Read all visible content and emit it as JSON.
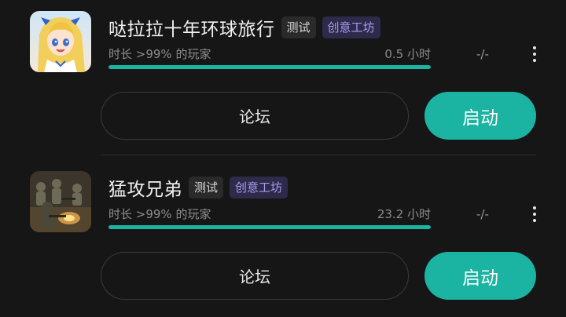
{
  "games": [
    {
      "name": "哒拉拉十年环球旅行",
      "tag_test": "测试",
      "tag_workshop": "创意工坊",
      "playtime_rank_label": "时长 >99% 的玩家",
      "playtime": "0.5 小时",
      "playtime_progress": 1.0,
      "rank_value": "-/-",
      "forum_label": "论坛",
      "launch_label": "启动",
      "thumbnail_icon": "anime-girl-thumbnail"
    },
    {
      "name": "猛攻兄弟",
      "tag_test": "测试",
      "tag_workshop": "创意工坊",
      "playtime_rank_label": "时长 >99% 的玩家",
      "playtime": "23.2 小时",
      "playtime_progress": 1.0,
      "rank_value": "-/-",
      "forum_label": "论坛",
      "launch_label": "启动",
      "thumbnail_icon": "soldiers-battle-thumbnail"
    }
  ],
  "colors": {
    "accent": "#1bb3a2",
    "background": "#161616",
    "workshop_tag_text": "#a69cf0",
    "workshop_tag_bg": "#2d2a4a"
  }
}
